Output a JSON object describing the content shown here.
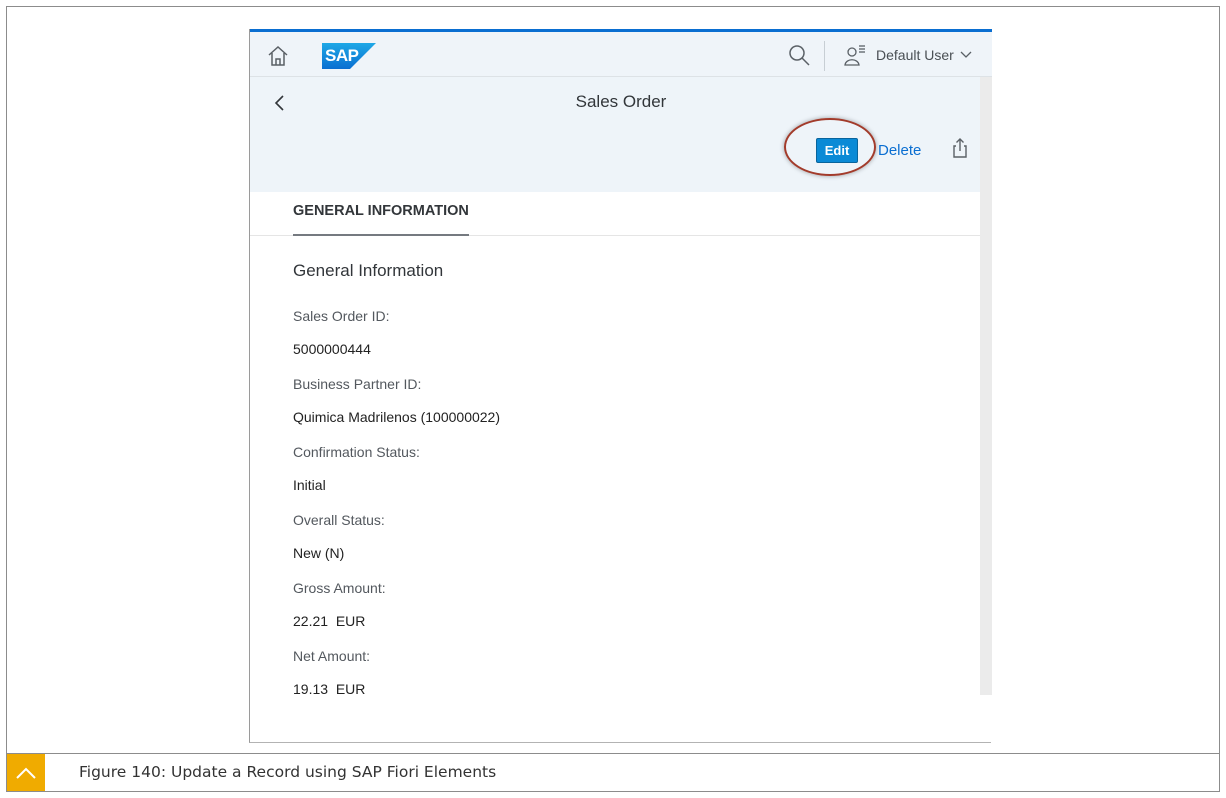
{
  "shell": {
    "logo_text": "SAP",
    "user_name": "Default User",
    "brand_color": "#0a6ed1"
  },
  "header": {
    "title": "Sales Order",
    "edit_label": "Edit",
    "delete_label": "Delete"
  },
  "tabs": [
    {
      "label": "GENERAL INFORMATION"
    }
  ],
  "section": {
    "title": "General Information",
    "fields": [
      {
        "label": "Sales Order ID:",
        "value": "5000000444"
      },
      {
        "label": "Business Partner ID:",
        "value": "Quimica Madrilenos (100000022)"
      },
      {
        "label": "Confirmation Status:",
        "value": "Initial"
      },
      {
        "label": "Overall Status:",
        "value": "New (N)"
      },
      {
        "label": "Gross Amount:",
        "value": "22.21  EUR"
      },
      {
        "label": "Net Amount:",
        "value": "19.13  EUR"
      }
    ]
  },
  "figure": {
    "caption": "Figure 140: Update a Record using SAP Fiori Elements",
    "accent_color": "#f0ab00"
  },
  "icons": {
    "home": "home-icon",
    "search": "search-icon",
    "user": "user-icon",
    "back": "chevron-left-icon",
    "share": "share-icon",
    "collapse": "chevron-up-icon"
  }
}
